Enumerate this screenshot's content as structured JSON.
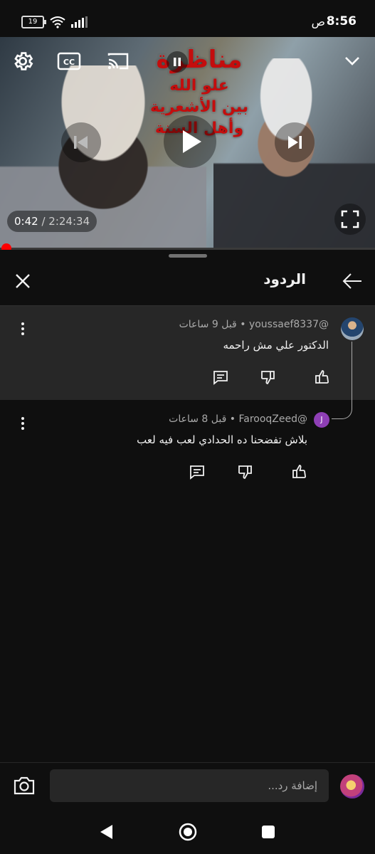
{
  "status_bar": {
    "time": "8:56",
    "ampm": "ص",
    "battery": "19"
  },
  "video": {
    "title_line1": "مناظرة",
    "title_line2": "علو الله",
    "title_line3": "بين الأشعرية",
    "title_line4": "وأهل السنة",
    "current_time": "0:42",
    "separator": " / ",
    "duration": "2:24:34",
    "progress_fraction": 0.005
  },
  "panel": {
    "title": "الردود"
  },
  "comments": [
    {
      "author": "@youssaef8337",
      "time": "قبل 9 ساعات",
      "dot": "•",
      "text": "الدكتور علي مش راحمه"
    },
    {
      "author": "@FarooqZeed",
      "avatar_letter": "J",
      "time": "قبل 8 ساعات",
      "dot": "•",
      "text": "بلاش تفضحنا ده الحدادي لعب فيه لعب"
    }
  ],
  "reply_input": {
    "placeholder": "إضافة رد..."
  },
  "colors": {
    "background": "#0f0f0f",
    "highlight_row": "#272727",
    "progress": "#ff0000",
    "avatar_purple": "#8e3fb5"
  }
}
